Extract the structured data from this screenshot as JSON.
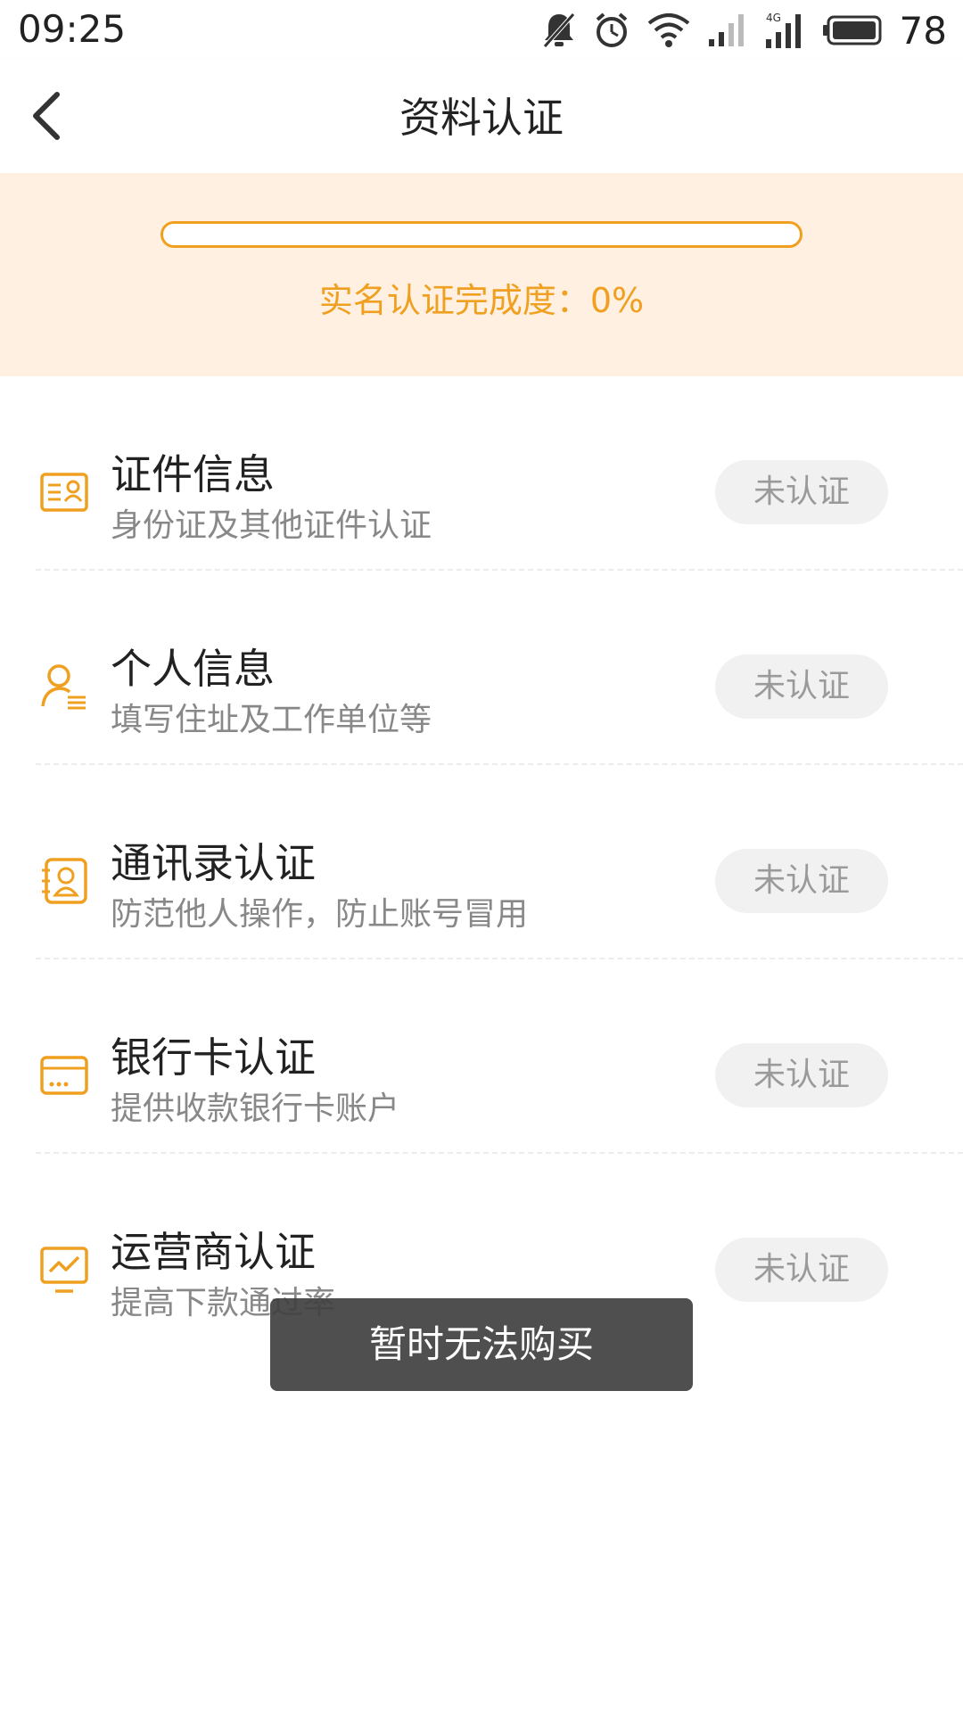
{
  "status_bar": {
    "time": "09:25",
    "network_label": "4G",
    "battery_percent": "78",
    "icons": [
      "mute-icon",
      "alarm-icon",
      "wifi-icon",
      "signal-icon",
      "signal-4g-icon",
      "battery-icon"
    ]
  },
  "header": {
    "title": "资料认证",
    "back_icon": "chevron-left-icon"
  },
  "progress": {
    "label": "实名认证完成度：0%",
    "value_percent": 0,
    "color": "#f0a020"
  },
  "auth_items": [
    {
      "title": "证件信息",
      "description": "身份证及其他证件认证",
      "status": "未认证",
      "icon": "id-card-icon"
    },
    {
      "title": "个人信息",
      "description": "填写住址及工作单位等",
      "status": "未认证",
      "icon": "person-info-icon"
    },
    {
      "title": "通讯录认证",
      "description": "防范他人操作，防止账号冒用",
      "status": "未认证",
      "icon": "contacts-icon"
    },
    {
      "title": "银行卡认证",
      "description": "提供收款银行卡账户",
      "status": "未认证",
      "icon": "bank-card-icon"
    },
    {
      "title": "运营商认证",
      "description": "提高下款通过率",
      "status": "未认证",
      "icon": "carrier-monitor-icon"
    }
  ],
  "toast": {
    "message": "暂时无法购买"
  },
  "colors": {
    "accent": "#f0a020",
    "banner_bg": "#fff0e1",
    "pill_bg": "#f1f1f1"
  }
}
